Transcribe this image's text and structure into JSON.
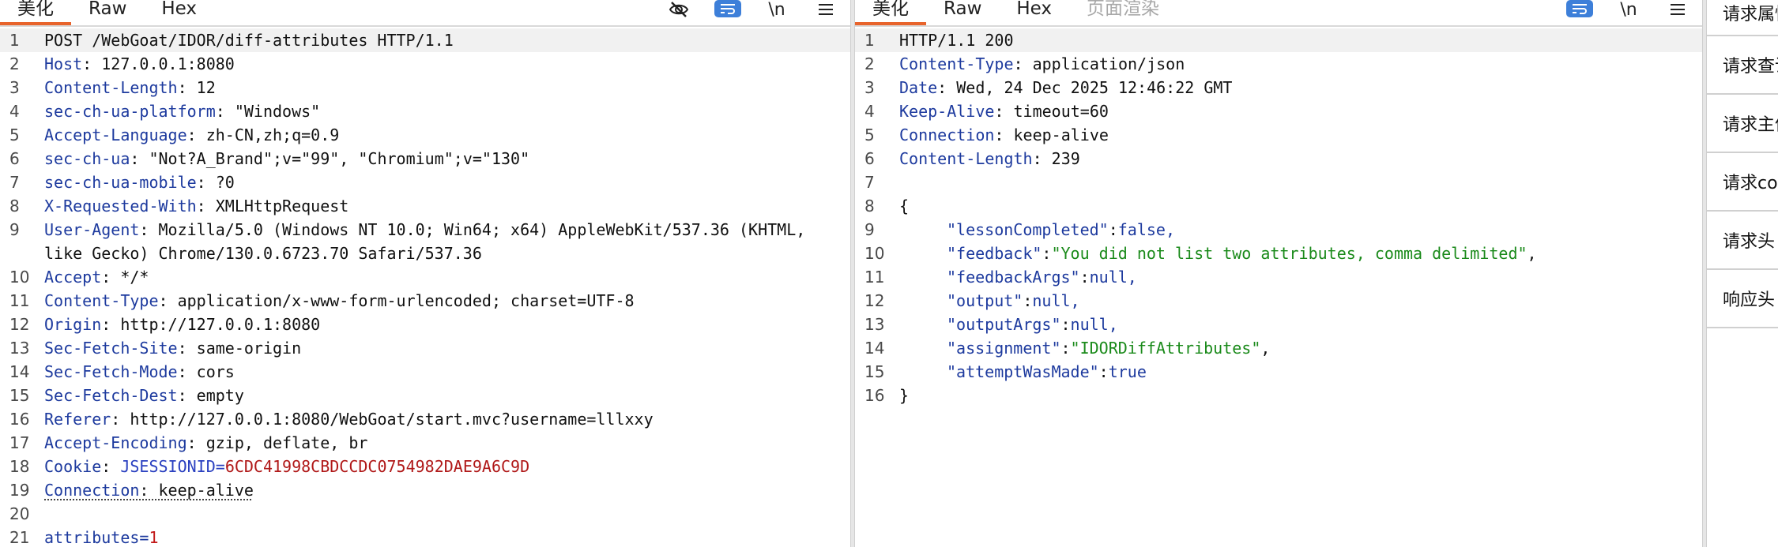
{
  "request": {
    "tabs": [
      {
        "label": "美化",
        "active": true
      },
      {
        "label": "Raw"
      },
      {
        "label": "Hex"
      }
    ],
    "icons": [
      "eye-off-icon",
      "wrap-lines-icon",
      "newline-icon",
      "menu-icon"
    ],
    "newline_glyph": "\\n",
    "lines": {
      "l1": "POST /WebGoat/IDOR/diff-attributes HTTP/1.1",
      "l2": {
        "name": "Host",
        "value": " 127.0.0.1:8080"
      },
      "l3": {
        "name": "Content-Length",
        "value": " 12"
      },
      "l4": {
        "name": "sec-ch-ua-platform",
        "value": " \"Windows\""
      },
      "l5": {
        "name": "Accept-Language",
        "value": " zh-CN,zh;q=0.9"
      },
      "l6": {
        "name": "sec-ch-ua",
        "value": " \"Not?A_Brand\";v=\"99\", \"Chromium\";v=\"130\""
      },
      "l7": {
        "name": "sec-ch-ua-mobile",
        "value": " ?0"
      },
      "l8": {
        "name": "X-Requested-With",
        "value": " XMLHttpRequest"
      },
      "l9": {
        "name": "User-Agent",
        "value": " Mozilla/5.0 (Windows NT 10.0; Win64; x64) AppleWebKit/537.36 (KHTML, like Gecko) Chrome/130.0.6723.70 Safari/537.36"
      },
      "l10": {
        "name": "Accept",
        "value": " */*"
      },
      "l11": {
        "name": "Content-Type",
        "value": " application/x-www-form-urlencoded; charset=UTF-8"
      },
      "l12": {
        "name": "Origin",
        "value": " http://127.0.0.1:8080"
      },
      "l13": {
        "name": "Sec-Fetch-Site",
        "value": " same-origin"
      },
      "l14": {
        "name": "Sec-Fetch-Mode",
        "value": " cors"
      },
      "l15": {
        "name": "Sec-Fetch-Dest",
        "value": " empty"
      },
      "l16": {
        "name": "Referer",
        "value": " http://127.0.0.1:8080/WebGoat/start.mvc?username=lllxxy"
      },
      "l17": {
        "name": "Accept-Encoding",
        "value": " gzip, deflate, br"
      },
      "l18": {
        "name": "Cookie",
        "cookie_name": "JSESSIONID",
        "cookie_value": "6CDC41998CBDCCDC0754982DAE9A6C9D"
      },
      "l19": {
        "name": "Connection",
        "value": " keep-alive"
      },
      "l21": {
        "param_name": "attributes",
        "param_value": "1"
      }
    }
  },
  "response": {
    "tabs": [
      {
        "label": "美化",
        "active": true
      },
      {
        "label": "Raw"
      },
      {
        "label": "Hex"
      },
      {
        "label": "页面渲染",
        "disabled": true
      }
    ],
    "icons": [
      "wrap-lines-icon",
      "newline-icon",
      "menu-icon"
    ],
    "newline_glyph": "\\n",
    "lines": {
      "l1": "HTTP/1.1 200",
      "l2": {
        "name": "Content-Type",
        "value": " application/json"
      },
      "l3": {
        "name": "Date",
        "value": " Wed, 24 Dec 2025 12:46:22 GMT"
      },
      "l4": {
        "name": "Keep-Alive",
        "value": " timeout=60"
      },
      "l5": {
        "name": "Connection",
        "value": " keep-alive"
      },
      "l6": {
        "name": "Content-Length",
        "value": " 239"
      },
      "l8": "{",
      "l9": {
        "key": "\"lessonCompleted\"",
        "value": "false,"
      },
      "l10": {
        "key": "\"feedback\"",
        "value": "\"You did not list two attributes, comma delimited\"",
        "tail": ","
      },
      "l11": {
        "key": "\"feedbackArgs\"",
        "value": "null,"
      },
      "l12": {
        "key": "\"output\"",
        "value": "null,"
      },
      "l13": {
        "key": "\"outputArgs\"",
        "value": "null,"
      },
      "l14": {
        "key": "\"assignment\"",
        "value": "\"IDORDiffAttributes\"",
        "tail": ","
      },
      "l15": {
        "key": "\"attemptWasMade\"",
        "value": "true"
      },
      "l16": "}"
    }
  },
  "side_panel": {
    "items": [
      "请求属性",
      "请求查询参数",
      "请求主体参数",
      "请求cookie",
      "请求头",
      "响应头"
    ]
  }
}
